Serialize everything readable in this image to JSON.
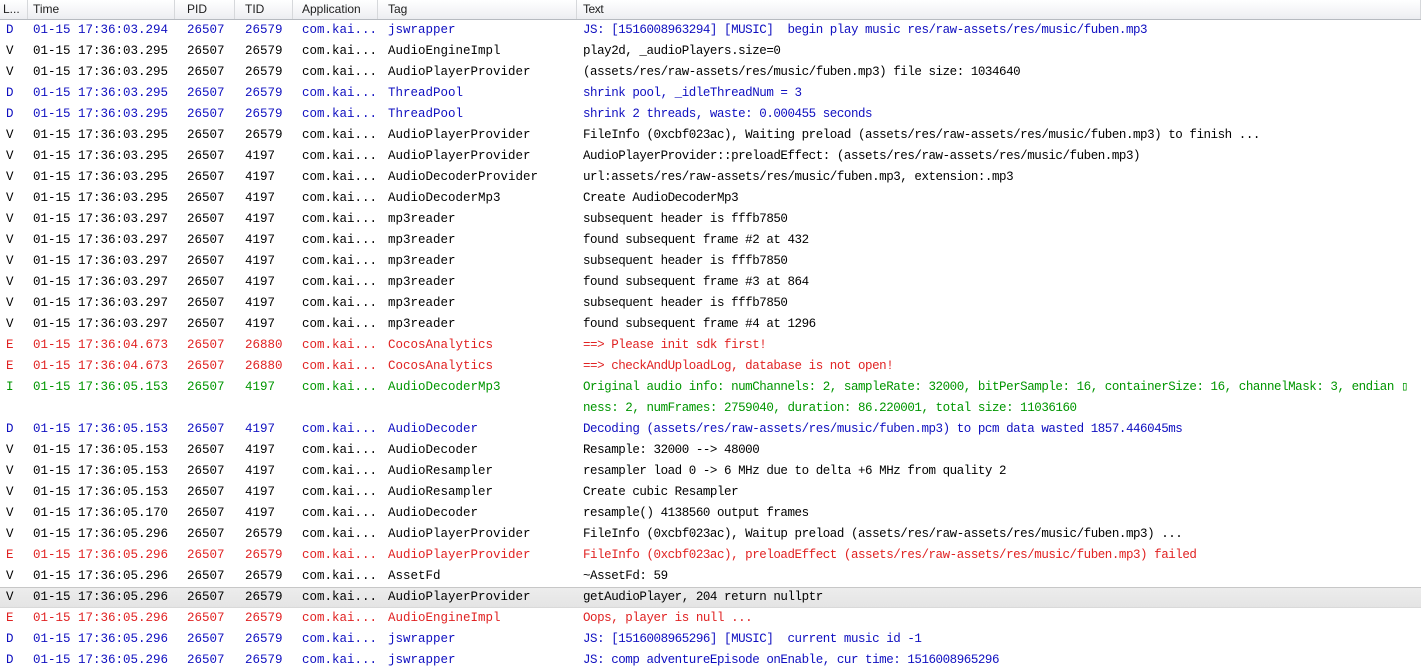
{
  "colors": {
    "verbose": "#000000",
    "debug": "#0f0fc0",
    "info": "#009600",
    "error": "#e02222",
    "selected_row_bg": "#e4e4e4",
    "header_border": "#b6bac0"
  },
  "table": {
    "columns": {
      "level": "L...",
      "time": "Time",
      "pid": "PID",
      "tid": "TID",
      "application": "Application",
      "tag": "Tag",
      "text": "Text"
    },
    "rows": [
      {
        "level": "D",
        "time": "01-15 17:36:03.294",
        "pid": "26507",
        "tid": "26579",
        "application": "com.kai...",
        "tag": "jswrapper",
        "text": "JS: [1516008963294] [MUSIC]  begin play music res/raw-assets/res/music/fuben.mp3"
      },
      {
        "level": "V",
        "time": "01-15 17:36:03.295",
        "pid": "26507",
        "tid": "26579",
        "application": "com.kai...",
        "tag": "AudioEngineImpl",
        "text": "play2d, _audioPlayers.size=0"
      },
      {
        "level": "V",
        "time": "01-15 17:36:03.295",
        "pid": "26507",
        "tid": "26579",
        "application": "com.kai...",
        "tag": "AudioPlayerProvider",
        "text": "(assets/res/raw-assets/res/music/fuben.mp3) file size: 1034640"
      },
      {
        "level": "D",
        "time": "01-15 17:36:03.295",
        "pid": "26507",
        "tid": "26579",
        "application": "com.kai...",
        "tag": "ThreadPool",
        "text": "shrink pool, _idleThreadNum = 3"
      },
      {
        "level": "D",
        "time": "01-15 17:36:03.295",
        "pid": "26507",
        "tid": "26579",
        "application": "com.kai...",
        "tag": "ThreadPool",
        "text": "shrink 2 threads, waste: 0.000455 seconds"
      },
      {
        "level": "V",
        "time": "01-15 17:36:03.295",
        "pid": "26507",
        "tid": "26579",
        "application": "com.kai...",
        "tag": "AudioPlayerProvider",
        "text": "FileInfo (0xcbf023ac), Waiting preload (assets/res/raw-assets/res/music/fuben.mp3) to finish ..."
      },
      {
        "level": "V",
        "time": "01-15 17:36:03.295",
        "pid": "26507",
        "tid": "4197",
        "application": "com.kai...",
        "tag": "AudioPlayerProvider",
        "text": "AudioPlayerProvider::preloadEffect: (assets/res/raw-assets/res/music/fuben.mp3)"
      },
      {
        "level": "V",
        "time": "01-15 17:36:03.295",
        "pid": "26507",
        "tid": "4197",
        "application": "com.kai...",
        "tag": "AudioDecoderProvider",
        "text": "url:assets/res/raw-assets/res/music/fuben.mp3, extension:.mp3"
      },
      {
        "level": "V",
        "time": "01-15 17:36:03.295",
        "pid": "26507",
        "tid": "4197",
        "application": "com.kai...",
        "tag": "AudioDecoderMp3",
        "text": "Create AudioDecoderMp3"
      },
      {
        "level": "V",
        "time": "01-15 17:36:03.297",
        "pid": "26507",
        "tid": "4197",
        "application": "com.kai...",
        "tag": "mp3reader",
        "text": "subsequent header is fffb7850"
      },
      {
        "level": "V",
        "time": "01-15 17:36:03.297",
        "pid": "26507",
        "tid": "4197",
        "application": "com.kai...",
        "tag": "mp3reader",
        "text": "found subsequent frame #2 at 432"
      },
      {
        "level": "V",
        "time": "01-15 17:36:03.297",
        "pid": "26507",
        "tid": "4197",
        "application": "com.kai...",
        "tag": "mp3reader",
        "text": "subsequent header is fffb7850"
      },
      {
        "level": "V",
        "time": "01-15 17:36:03.297",
        "pid": "26507",
        "tid": "4197",
        "application": "com.kai...",
        "tag": "mp3reader",
        "text": "found subsequent frame #3 at 864"
      },
      {
        "level": "V",
        "time": "01-15 17:36:03.297",
        "pid": "26507",
        "tid": "4197",
        "application": "com.kai...",
        "tag": "mp3reader",
        "text": "subsequent header is fffb7850"
      },
      {
        "level": "V",
        "time": "01-15 17:36:03.297",
        "pid": "26507",
        "tid": "4197",
        "application": "com.kai...",
        "tag": "mp3reader",
        "text": "found subsequent frame #4 at 1296"
      },
      {
        "level": "E",
        "time": "01-15 17:36:04.673",
        "pid": "26507",
        "tid": "26880",
        "application": "com.kai...",
        "tag": "CocosAnalytics",
        "text": "==> Please init sdk first!"
      },
      {
        "level": "E",
        "time": "01-15 17:36:04.673",
        "pid": "26507",
        "tid": "26880",
        "application": "com.kai...",
        "tag": "CocosAnalytics",
        "text": "==> checkAndUploadLog, database is not open!"
      },
      {
        "level": "I",
        "time": "01-15 17:36:05.153",
        "pid": "26507",
        "tid": "4197",
        "application": "com.kai...",
        "tag": "AudioDecoderMp3",
        "text": "Original audio info: numChannels: 2, sampleRate: 32000, bitPerSample: 16, containerSize: 16, channelMask: 3, endian ▯\nness: 2, numFrames: 2759040, duration: 86.220001, total size: 11036160"
      },
      {
        "level": "D",
        "time": "01-15 17:36:05.153",
        "pid": "26507",
        "tid": "4197",
        "application": "com.kai...",
        "tag": "AudioDecoder",
        "text": "Decoding (assets/res/raw-assets/res/music/fuben.mp3) to pcm data wasted 1857.446045ms"
      },
      {
        "level": "V",
        "time": "01-15 17:36:05.153",
        "pid": "26507",
        "tid": "4197",
        "application": "com.kai...",
        "tag": "AudioDecoder",
        "text": "Resample: 32000 --> 48000"
      },
      {
        "level": "V",
        "time": "01-15 17:36:05.153",
        "pid": "26507",
        "tid": "4197",
        "application": "com.kai...",
        "tag": "AudioResampler",
        "text": "resampler load 0 -> 6 MHz due to delta +6 MHz from quality 2"
      },
      {
        "level": "V",
        "time": "01-15 17:36:05.153",
        "pid": "26507",
        "tid": "4197",
        "application": "com.kai...",
        "tag": "AudioResampler",
        "text": "Create cubic Resampler"
      },
      {
        "level": "V",
        "time": "01-15 17:36:05.170",
        "pid": "26507",
        "tid": "4197",
        "application": "com.kai...",
        "tag": "AudioDecoder",
        "text": "resample() 4138560 output frames"
      },
      {
        "level": "V",
        "time": "01-15 17:36:05.296",
        "pid": "26507",
        "tid": "26579",
        "application": "com.kai...",
        "tag": "AudioPlayerProvider",
        "text": "FileInfo (0xcbf023ac), Waitup preload (assets/res/raw-assets/res/music/fuben.mp3) ..."
      },
      {
        "level": "E",
        "time": "01-15 17:36:05.296",
        "pid": "26507",
        "tid": "26579",
        "application": "com.kai...",
        "tag": "AudioPlayerProvider",
        "text": "FileInfo (0xcbf023ac), preloadEffect (assets/res/raw-assets/res/music/fuben.mp3) failed"
      },
      {
        "level": "V",
        "time": "01-15 17:36:05.296",
        "pid": "26507",
        "tid": "26579",
        "application": "com.kai...",
        "tag": "AssetFd",
        "text": "~AssetFd: 59"
      },
      {
        "level": "V",
        "time": "01-15 17:36:05.296",
        "pid": "26507",
        "tid": "26579",
        "application": "com.kai...",
        "tag": "AudioPlayerProvider",
        "text": "getAudioPlayer, 204 return nullptr",
        "selected": true
      },
      {
        "level": "E",
        "time": "01-15 17:36:05.296",
        "pid": "26507",
        "tid": "26579",
        "application": "com.kai...",
        "tag": "AudioEngineImpl",
        "text": "Oops, player is null ..."
      },
      {
        "level": "D",
        "time": "01-15 17:36:05.296",
        "pid": "26507",
        "tid": "26579",
        "application": "com.kai...",
        "tag": "jswrapper",
        "text": "JS: [1516008965296] [MUSIC]  current music id -1"
      },
      {
        "level": "D",
        "time": "01-15 17:36:05.296",
        "pid": "26507",
        "tid": "26579",
        "application": "com.kai...",
        "tag": "jswrapper",
        "text": "JS: comp adventureEpisode onEnable, cur time: 1516008965296"
      }
    ]
  }
}
